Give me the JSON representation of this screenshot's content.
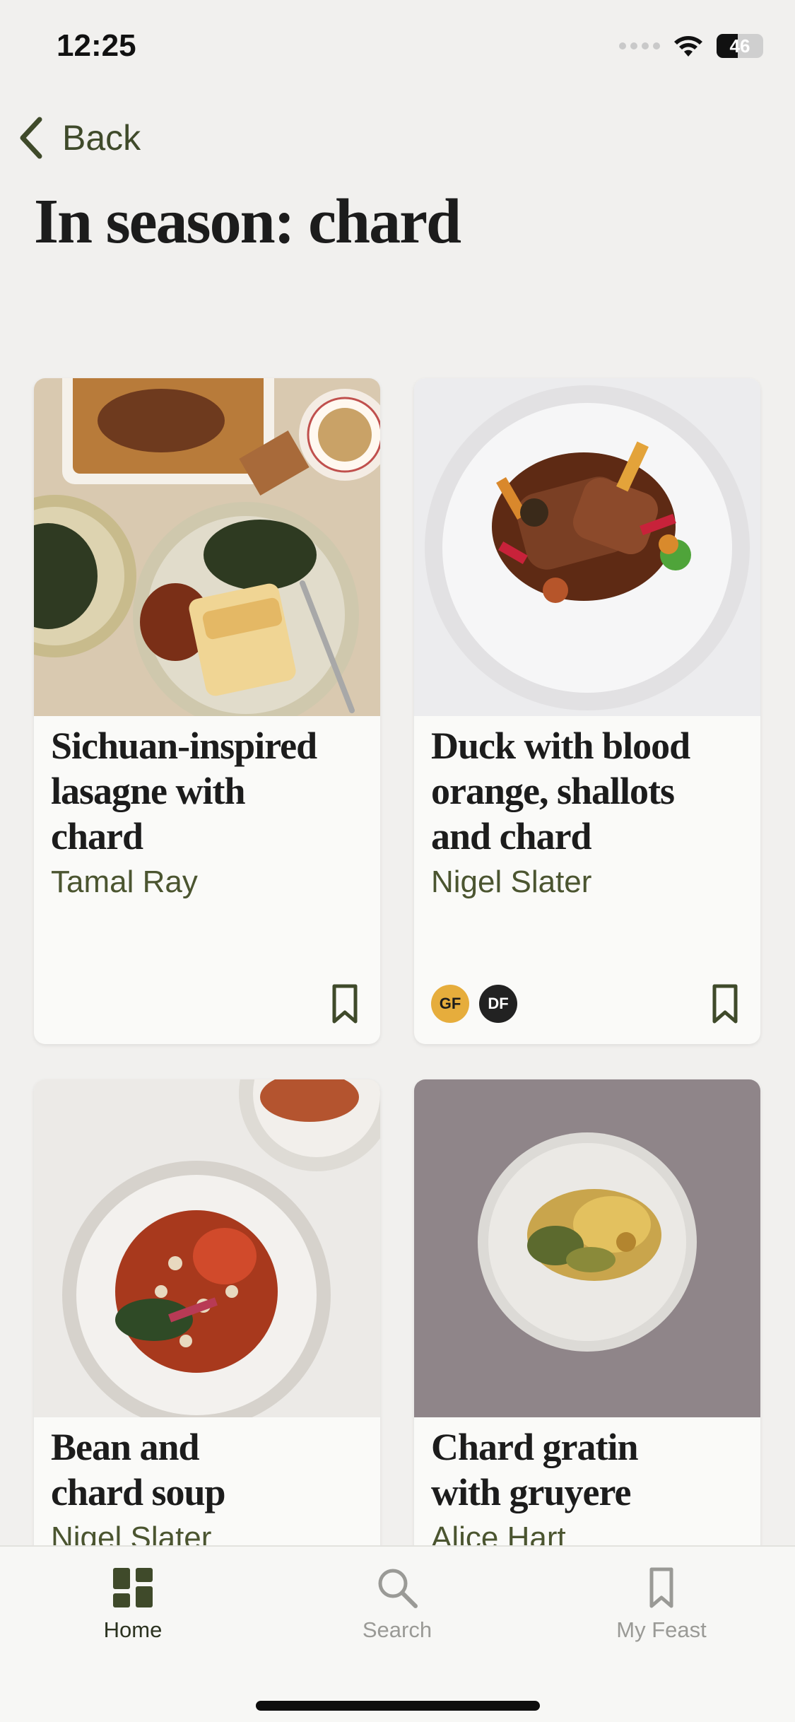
{
  "status_bar": {
    "time": "12:25",
    "battery": "46",
    "battery_level": 0.46
  },
  "nav": {
    "back_label": "Back"
  },
  "page": {
    "title": "In season: chard"
  },
  "recipes": [
    {
      "title_lines": [
        "Sichuan-inspired",
        "lasagne with",
        "chard"
      ],
      "author": "Tamal Ray",
      "tags": []
    },
    {
      "title_lines": [
        "Duck with blood",
        "orange, shallots",
        "and chard"
      ],
      "author": "Nigel Slater",
      "tags": [
        {
          "label": "GF",
          "color": "#e6ad3c",
          "text_color": "#1c1c1c"
        },
        {
          "label": "DF",
          "color": "#222222",
          "text_color": "#ffffff"
        }
      ]
    },
    {
      "title_lines": [
        "Bean and",
        "chard soup"
      ],
      "author": "Nigel Slater",
      "tags": []
    },
    {
      "title_lines": [
        "Chard gratin",
        "with gruyere"
      ],
      "author": "Alice Hart",
      "tags": []
    }
  ],
  "tabbar": {
    "tabs": [
      {
        "label": "Home",
        "icon": "grid-icon",
        "active": true
      },
      {
        "label": "Search",
        "icon": "search-icon",
        "active": false
      },
      {
        "label": "My Feast",
        "icon": "bookmark-icon",
        "active": false
      }
    ]
  },
  "colors": {
    "accent": "#3f4a2a",
    "inactive": "#9a9a96",
    "background": "#f1f0ee"
  }
}
